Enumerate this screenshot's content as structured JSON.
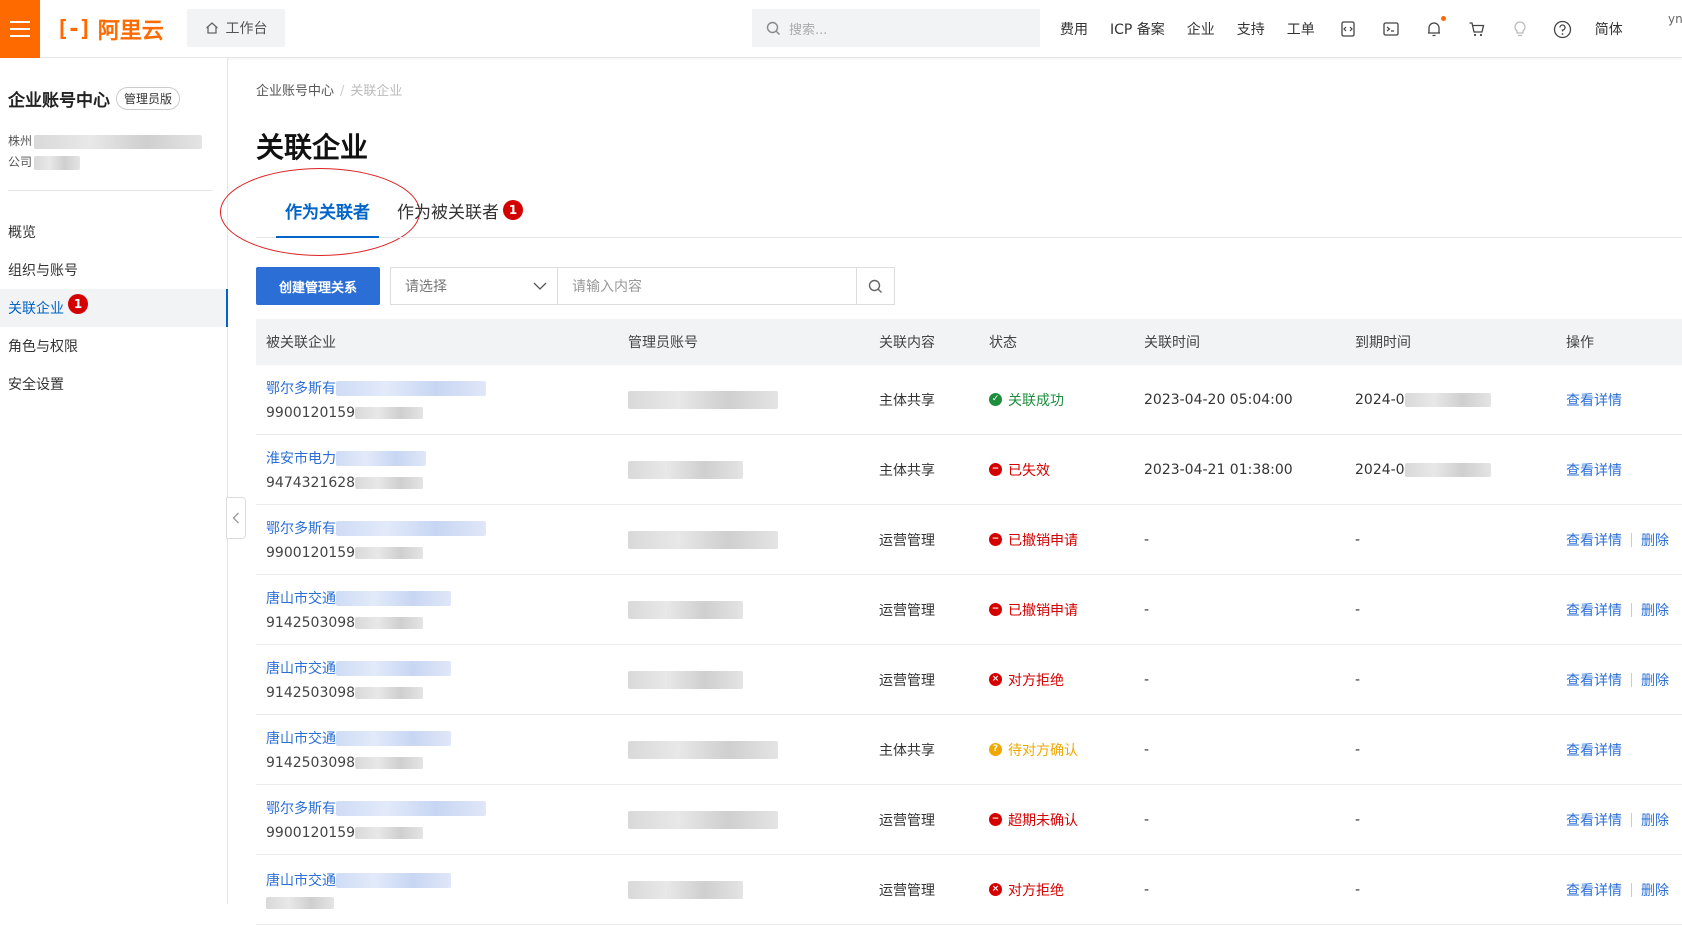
{
  "header": {
    "logo_mark": "[-]",
    "logo_text": "阿里云",
    "workbench": "工作台",
    "search_placeholder": "搜索...",
    "nav": [
      "费用",
      "ICP 备案",
      "企业",
      "支持",
      "工单"
    ],
    "lang": "简体",
    "user": "yn",
    "accent": "#ff6a00"
  },
  "sidebar": {
    "title": "企业账号中心",
    "badge": "管理员版",
    "org_line1": "株州",
    "org_line2": "公司",
    "items": [
      {
        "label": "概览"
      },
      {
        "label": "组织与账号"
      },
      {
        "label": "关联企业",
        "badge": "1"
      },
      {
        "label": "角色与权限"
      },
      {
        "label": "安全设置"
      }
    ]
  },
  "main": {
    "breadcrumb": [
      "企业账号中心",
      "关联企业"
    ],
    "breadcrumb_sep": "/",
    "title": "关联企业",
    "tabs": [
      {
        "label": "作为关联者"
      },
      {
        "label": "作为被关联者",
        "badge": "1"
      }
    ],
    "create_button": "创建管理关系",
    "select_placeholder": "请选择",
    "input_placeholder": "请输入内容"
  },
  "table": {
    "columns": [
      "被关联企业",
      "管理员账号",
      "关联内容",
      "状态",
      "关联时间",
      "到期时间",
      "操作"
    ],
    "rows": [
      {
        "name": "鄂尔多斯有",
        "code": "9900120159",
        "content": "主体共享",
        "status": "关联成功",
        "status_type": "success",
        "start": "2023-04-20 05:04:00",
        "end": "2024-0",
        "view": "查看详情",
        "delete": ""
      },
      {
        "name": "淮安市电力",
        "code": "9474321628",
        "content": "主体共享",
        "status": "已失效",
        "status_type": "error",
        "start": "2023-04-21 01:38:00",
        "end": "2024-0",
        "view": "查看详情",
        "delete": ""
      },
      {
        "name": "鄂尔多斯有",
        "code": "9900120159",
        "content": "运营管理",
        "status": "已撤销申请",
        "status_type": "error",
        "start": "-",
        "end": "-",
        "view": "查看详情",
        "delete": "删除"
      },
      {
        "name": "唐山市交通",
        "code": "9142503098",
        "content": "运营管理",
        "status": "已撤销申请",
        "status_type": "error",
        "start": "-",
        "end": "-",
        "view": "查看详情",
        "delete": "删除"
      },
      {
        "name": "唐山市交通",
        "code": "9142503098",
        "content": "运营管理",
        "status": "对方拒绝",
        "status_type": "reject",
        "start": "-",
        "end": "-",
        "view": "查看详情",
        "delete": "删除"
      },
      {
        "name": "唐山市交通",
        "code": "9142503098",
        "content": "主体共享",
        "status": "待对方确认",
        "status_type": "pending",
        "start": "-",
        "end": "-",
        "view": "查看详情",
        "delete": ""
      },
      {
        "name": "鄂尔多斯有",
        "code": "9900120159",
        "content": "运营管理",
        "status": "超期未确认",
        "status_type": "error",
        "start": "-",
        "end": "-",
        "view": "查看详情",
        "delete": "删除"
      },
      {
        "name": "唐山市交通",
        "code": "",
        "content": "运营管理",
        "status": "对方拒绝",
        "status_type": "reject",
        "start": "-",
        "end": "-",
        "view": "查看详情",
        "delete": "删除"
      }
    ],
    "status_colors": {
      "success": "#1e8e3e",
      "error": "#d40000",
      "reject": "#d40000",
      "pending": "#f0a800"
    }
  }
}
